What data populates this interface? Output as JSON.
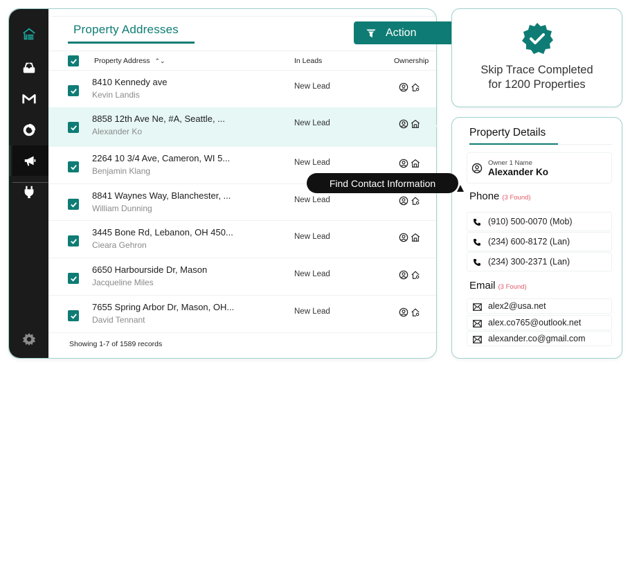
{
  "sidebar": {
    "items": [
      {
        "icon": "home-logo-icon"
      },
      {
        "icon": "inbox-icon"
      },
      {
        "icon": "gmail-icon"
      },
      {
        "icon": "chart-ring-icon"
      },
      {
        "icon": "megaphone-icon",
        "active": true
      },
      {
        "icon": "plug-icon"
      },
      {
        "icon": "gear-icon"
      }
    ]
  },
  "tab": {
    "label": "Property Addresses"
  },
  "table": {
    "headers": {
      "address": "Property Address",
      "leads": "In Leads",
      "ownership": "Ownership"
    },
    "rows": [
      {
        "address": "8410 Kennedy ave",
        "owner": "Kevin Landis",
        "lead": "New Lead"
      },
      {
        "address": "8858 12th Ave Ne, #A, Seattle, ...",
        "owner": "Alexander Ko",
        "lead": "New Lead"
      },
      {
        "address": "2264 10 3/4 Ave, Cameron, WI 5...",
        "owner": "Benjamin Klang",
        "lead": "New Lead"
      },
      {
        "address": "8841 Waynes Way, Blanchester, ...",
        "owner": "William Dunning",
        "lead": "New Lead"
      },
      {
        "address": "3445 Bone Rd, Lebanon, OH 450...",
        "owner": "Cieara Gehron",
        "lead": "New Lead"
      },
      {
        "address": "6650 Harbourside Dr, Mason",
        "owner": "Jacqueline Miles",
        "lead": "New Lead"
      },
      {
        "address": "7655 Spring Arbor Dr, Mason, OH...",
        "owner": "David Tennant",
        "lead": "New Lead"
      }
    ],
    "footer": "Showing 1-7 of 1589 records"
  },
  "action": {
    "label": "Action"
  },
  "tooltip": {
    "label": "Find Contact Information"
  },
  "skip_trace": {
    "line1": "Skip Trace Completed",
    "line2": "for 1200 Properties"
  },
  "details": {
    "title": "Property Details",
    "owner_label": "Owner 1 Name",
    "owner_name": "Alexander Ko",
    "phone_label": "Phone",
    "phone_count": "(3 Found)",
    "phones": [
      "(910) 500-0070 (Mob)",
      "(234) 600-8172 (Lan)",
      "(234) 300-2371 (Lan)"
    ],
    "email_label": "Email",
    "email_count": "(3 Found)",
    "emails": [
      "alex2@usa.net",
      "alex.co765@outlook.net",
      "alexander.co@gmail.com"
    ]
  },
  "colors": {
    "accent": "#0e7c74",
    "sidebar": "#1b1b1b",
    "highlight": "#e6f7f5",
    "count": "#e05a6a"
  }
}
